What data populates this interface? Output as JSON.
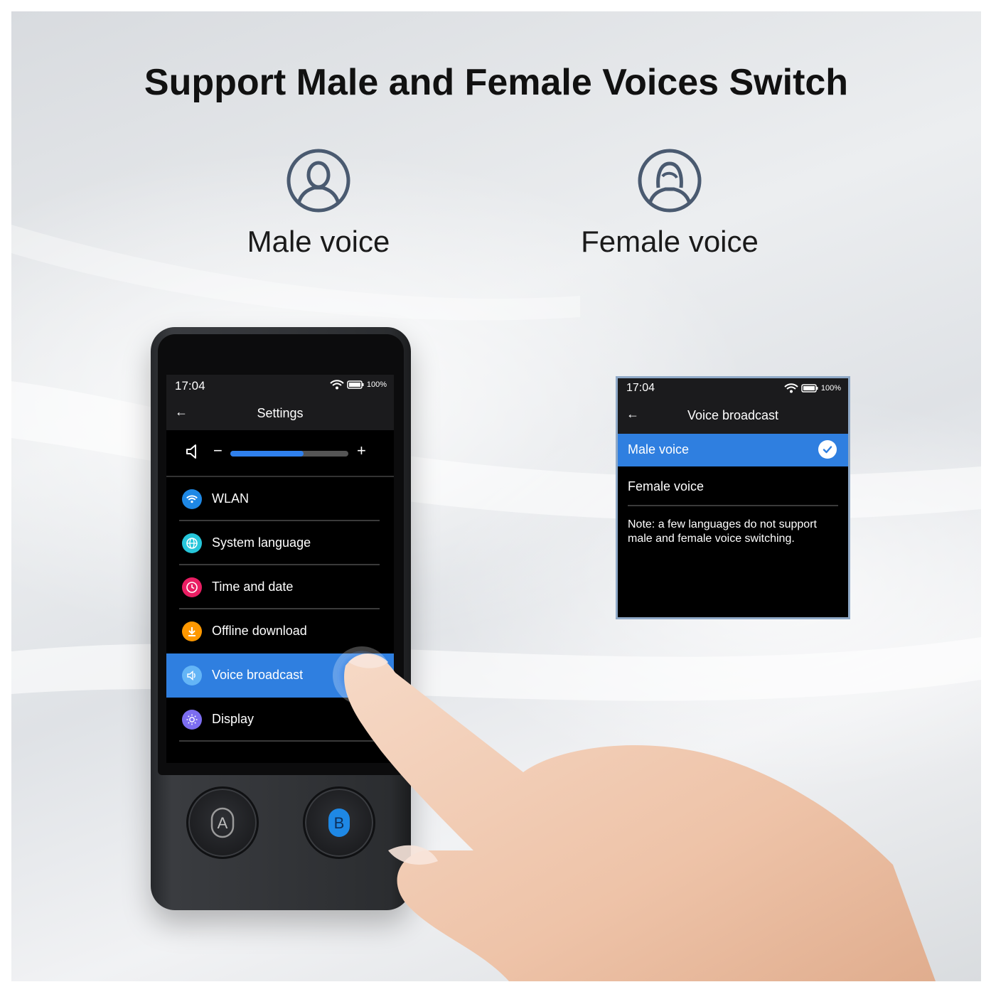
{
  "headline": "Support Male and Female Voices Switch",
  "voices": {
    "male_label": "Male voice",
    "female_label": "Female voice",
    "male_icon": "male-user-icon",
    "female_icon": "female-user-icon"
  },
  "device": {
    "status": {
      "time": "17:04",
      "battery": "100%"
    },
    "nav": {
      "title": "Settings"
    },
    "volume": {
      "minus": "−",
      "plus": "+",
      "level": 0.62
    },
    "menu": [
      {
        "label": "WLAN",
        "icon": "wifi-icon",
        "color": "#1e88e5"
      },
      {
        "label": "System language",
        "icon": "globe-icon",
        "color": "#26c6da"
      },
      {
        "label": "Time and date",
        "icon": "clock-icon",
        "color": "#e91e63"
      },
      {
        "label": "Offline download",
        "icon": "download-icon",
        "color": "#ff9800"
      },
      {
        "label": "Voice broadcast",
        "icon": "speaker-icon",
        "color": "#64b5f6",
        "active": true
      },
      {
        "label": "Display",
        "icon": "brightness-icon",
        "color": "#7c6df0"
      }
    ],
    "buttons": {
      "a": "A",
      "b": "B"
    }
  },
  "panel": {
    "status": {
      "time": "17:04",
      "battery": "100%"
    },
    "nav": {
      "title": "Voice broadcast"
    },
    "options": [
      {
        "label": "Male voice",
        "selected": true
      },
      {
        "label": "Female voice",
        "selected": false
      }
    ],
    "note": "Note: a few languages do not support male and female voice switching."
  },
  "colors": {
    "accent": "#2f7fe0",
    "icon_stroke": "#4a5a70"
  }
}
